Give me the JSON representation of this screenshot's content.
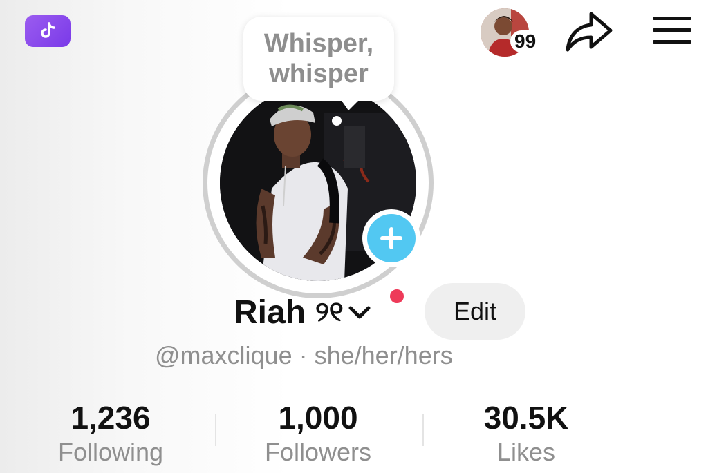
{
  "header": {
    "badge_icon": "tiktok-ticket-icon",
    "badge_color": "#8a4cf0",
    "notifications_count": "99",
    "share_icon": "share-arrow-icon",
    "menu_icon": "hamburger-menu-icon"
  },
  "bubble": {
    "line1": "Whisper,",
    "line2": "whisper"
  },
  "profile": {
    "add_icon": "plus-icon",
    "add_color": "#52c8f2",
    "name": "Riah",
    "name_deco": "୨୧",
    "chevron_icon": "chevron-down-icon",
    "dot_color": "#ee3a59",
    "edit_label": "Edit",
    "handle": "@maxclique · she/her/hers"
  },
  "stats": [
    {
      "value": "1,236",
      "label": "Following"
    },
    {
      "value": "1,000",
      "label": "Followers"
    },
    {
      "value": "30.5K",
      "label": "Likes"
    }
  ]
}
